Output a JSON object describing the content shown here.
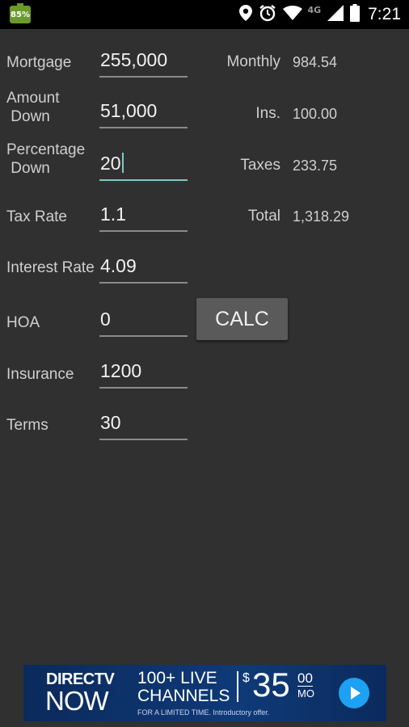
{
  "status_bar": {
    "battery_percent": "85%",
    "network": "4G",
    "time": "7:21",
    "icons": [
      "location-icon",
      "alarm-icon",
      "wifi-icon",
      "signal-icon",
      "battery-icon"
    ]
  },
  "form": {
    "fields": [
      {
        "id": "mortgage",
        "label": "Mortgage",
        "value": "255,000"
      },
      {
        "id": "amount_down",
        "label": "Amount\n Down",
        "value": "51,000"
      },
      {
        "id": "percentage_down",
        "label": "Percentage\n Down",
        "value": "20"
      },
      {
        "id": "tax_rate",
        "label": "Tax Rate",
        "value": "1.1"
      },
      {
        "id": "interest_rate",
        "label": "Interest Rate",
        "value": "4.09"
      },
      {
        "id": "hoa",
        "label": "HOA",
        "value": "0"
      },
      {
        "id": "insurance",
        "label": "Insurance",
        "value": "1200"
      },
      {
        "id": "terms",
        "label": "Terms",
        "value": "30"
      }
    ],
    "calc_label": "CALC"
  },
  "results": [
    {
      "label": "Monthly",
      "value": "984.54"
    },
    {
      "label": "Ins.",
      "value": "100.00"
    },
    {
      "label": "Taxes",
      "value": "233.75"
    },
    {
      "label": "Total",
      "value": "1,318.29"
    }
  ],
  "ad": {
    "brand": "DIRECTV",
    "brand_sub": "NOW",
    "headline": "100+ LIVE\nCHANNELS",
    "dollar": "$",
    "price": "35",
    "cents": "00",
    "per": "MO",
    "fine_print": "FOR A LIMITED TIME. Introductory offer."
  },
  "colors": {
    "background": "#303030",
    "accent": "#80cbc4",
    "button": "#5a5a5a"
  }
}
